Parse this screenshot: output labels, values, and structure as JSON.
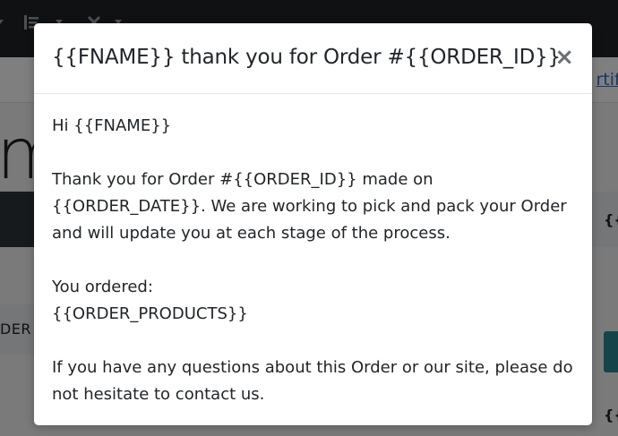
{
  "background": {
    "link_text": "rtifi",
    "big_letter": "m",
    "right_text_1": "{{",
    "left_text": "DER",
    "right_text_2": "{{"
  },
  "modal": {
    "title": "{{FNAME}} thank you for Order #{{ORDER_ID}}",
    "close_label": "×",
    "body": {
      "greeting": "Hi {{FNAME}}",
      "paragraph_1": "Thank you for Order #{{ORDER_ID}} made on {{ORDER_DATE}}. We are working to pick and pack your Order and will update you at each stage of the process.",
      "ordered_label": "You ordered:",
      "ordered_products": "{{ORDER_PRODUCTS}}",
      "paragraph_3": "If you have any questions about this Order or our site, please do not hesitate to contact us."
    }
  },
  "colors": {
    "topbar": "#1f2227",
    "overlay": "rgba(0,0,0,0.5)",
    "link": "#2b6cd4",
    "teal_button": "#2a8b94"
  },
  "icons": {
    "topbar_icon_1": "chevron-down-icon",
    "topbar_icon_2": "list-icon",
    "topbar_icon_3": "tools-icon"
  }
}
